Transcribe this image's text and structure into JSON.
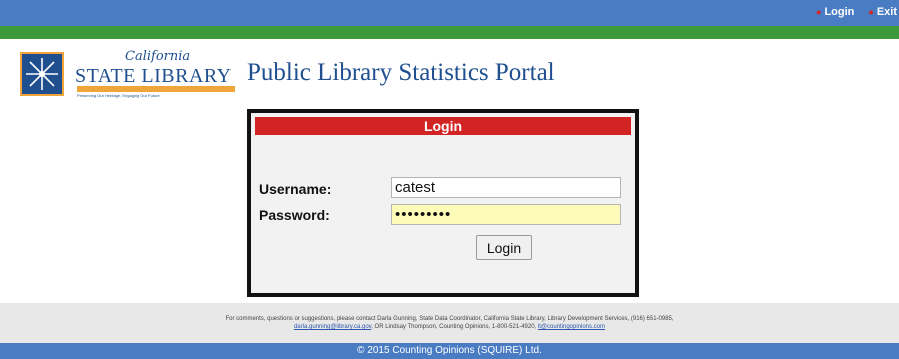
{
  "nav": {
    "login_label": "Login",
    "exit_label": "Exit"
  },
  "branding": {
    "logo_script": "California",
    "logo_main": "STATE LIBRARY",
    "logo_tagline": "Preserving Our Heritage, Engaging Our Future",
    "site_title": "Public Library Statistics Portal"
  },
  "login": {
    "header": "Login",
    "username_label": "Username:",
    "username_value": "catest",
    "password_label": "Password:",
    "password_value": "•••••••••",
    "button_label": "Login"
  },
  "footer": {
    "info_line1": "For comments, questions or suggestions, please contact Darla Gunning, State Data Coordinator, California State Library, Library Development Services, (916) 651-0985,",
    "darla_email": "darla.gunning@library.ca.gov",
    "info_line2_middle": ", OR Lindsay Thompson, Counting Opinions, 1-800-521-4920,",
    "support_email": "lt@countingopinions.com",
    "copyright": "© 2015 Counting Opinions (SQUIRE) Ltd."
  },
  "colors": {
    "top_bar": "#4a7cc4",
    "green_bar": "#3d9a3a",
    "login_header": "#d32424",
    "brand_blue": "#1f4f8f",
    "brand_orange": "#f0a53a"
  }
}
